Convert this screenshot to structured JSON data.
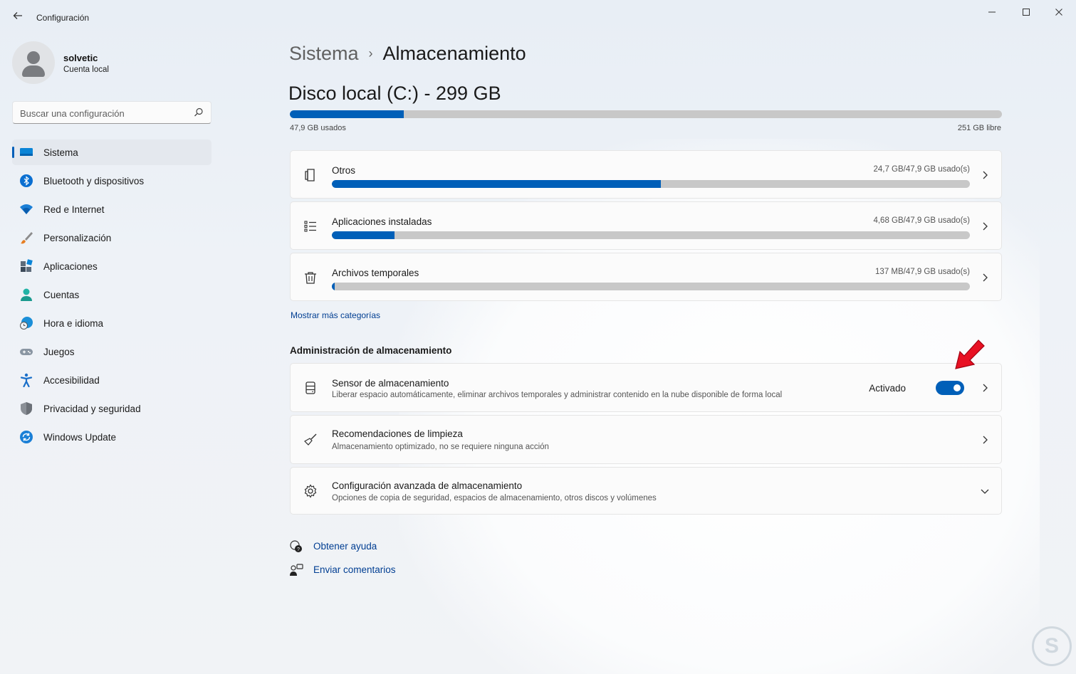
{
  "window": {
    "title": "Configuración",
    "back_icon": "back-arrow-icon",
    "minimize_icon": "minimize-icon",
    "maximize_icon": "maximize-icon",
    "close_icon": "close-icon"
  },
  "user": {
    "name": "solvetic",
    "account_type": "Cuenta local"
  },
  "search": {
    "placeholder": "Buscar una configuración",
    "value": ""
  },
  "sidebar": {
    "items": [
      {
        "label": "Sistema",
        "icon": "system-display-icon",
        "active": true
      },
      {
        "label": "Bluetooth y dispositivos",
        "icon": "bluetooth-icon"
      },
      {
        "label": "Red e Internet",
        "icon": "wifi-icon"
      },
      {
        "label": "Personalización",
        "icon": "paintbrush-icon"
      },
      {
        "label": "Aplicaciones",
        "icon": "apps-icon"
      },
      {
        "label": "Cuentas",
        "icon": "person-icon"
      },
      {
        "label": "Hora e idioma",
        "icon": "globe-clock-icon"
      },
      {
        "label": "Juegos",
        "icon": "gamepad-icon"
      },
      {
        "label": "Accesibilidad",
        "icon": "accessibility-icon"
      },
      {
        "label": "Privacidad y seguridad",
        "icon": "shield-icon"
      },
      {
        "label": "Windows Update",
        "icon": "update-icon"
      }
    ]
  },
  "breadcrumb": {
    "parent": "Sistema",
    "separator": "›",
    "current": "Almacenamiento"
  },
  "disk": {
    "title": "Disco local (C:) - 299 GB",
    "used_label": "47,9 GB usados",
    "free_label": "251 GB libre",
    "used_fraction": 0.16
  },
  "categories": [
    {
      "title": "Otros",
      "value": "24,7 GB/47,9 GB usado(s)",
      "fraction": 0.516,
      "icon": "other-files-icon"
    },
    {
      "title": "Aplicaciones instaladas",
      "value": "4,68 GB/47,9 GB usado(s)",
      "fraction": 0.098,
      "icon": "list-icon"
    },
    {
      "title": "Archivos temporales",
      "value": "137 MB/47,9 GB usado(s)",
      "fraction": 0.004,
      "icon": "trash-icon"
    }
  ],
  "show_more_link": "Mostrar más categorías",
  "management": {
    "title": "Administración de almacenamiento",
    "sensor": {
      "title": "Sensor de almacenamiento",
      "subtitle": "Liberar espacio automáticamente, eliminar archivos temporales y administrar contenido en la nube disponible de forma local",
      "toggle_label": "Activado",
      "toggle_on": true,
      "icon": "storage-drive-icon"
    },
    "cleanup": {
      "title": "Recomendaciones de limpieza",
      "subtitle": "Almacenamiento optimizado, no se requiere ninguna acción",
      "icon": "broom-icon"
    },
    "advanced": {
      "title": "Configuración avanzada de almacenamiento",
      "subtitle": "Opciones de copia de seguridad, espacios de almacenamiento, otros discos y volúmenes",
      "icon": "gear-icon"
    }
  },
  "help": {
    "get_help": "Obtener ayuda",
    "feedback": "Enviar comentarios"
  },
  "colors": {
    "accent": "#005fb8",
    "bar_track": "#c8c8c8",
    "link": "#003e92",
    "annotation_arrow": "#e81123"
  }
}
